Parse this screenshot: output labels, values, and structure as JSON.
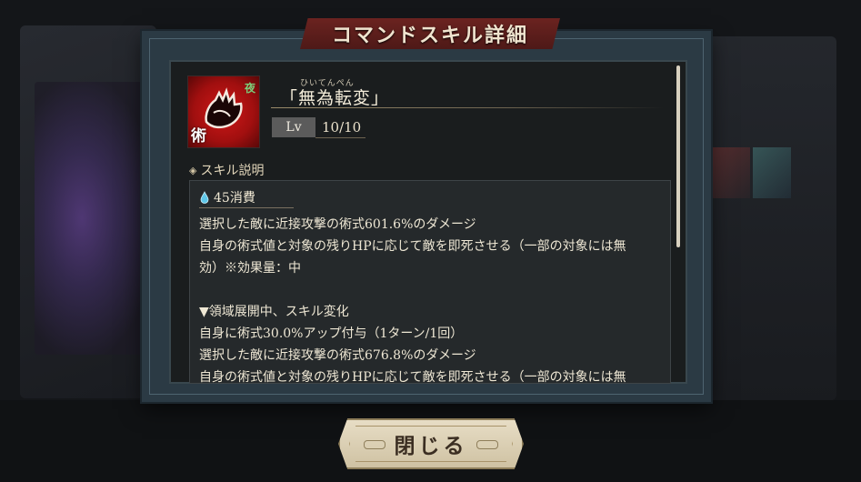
{
  "dialog": {
    "title": "コマンドスキル詳細"
  },
  "skill": {
    "icon_char": "術",
    "icon_mark": "夜",
    "ruby": "ひいてんぺん",
    "name": "「無為転変」",
    "level_label": "Lv",
    "level_value": "10/10"
  },
  "description": {
    "section_label": "スキル説明",
    "cost": "45消費",
    "lines": [
      "選択した敵に近接攻撃の術式601.6%のダメージ",
      "自身の術式値と対象の残りHPに応じて敵を即死させる（一部の対象には無",
      "効）※効果量：中",
      "",
      "▼領域展開中、スキル変化",
      "自身に術式30.0%アップ付与（1ターン/1回）",
      "選択した敵に近接攻撃の術式676.8%のダメージ",
      "自身の術式値と対象の残りHPに応じて敵を即死させる（一部の対象には無"
    ]
  },
  "buttons": {
    "close_label": "閉じる"
  },
  "colors": {
    "banner": "#6b2320",
    "icon_red": "#d01818",
    "panel": "#1a1d1e",
    "button": "#e7ddc5"
  }
}
